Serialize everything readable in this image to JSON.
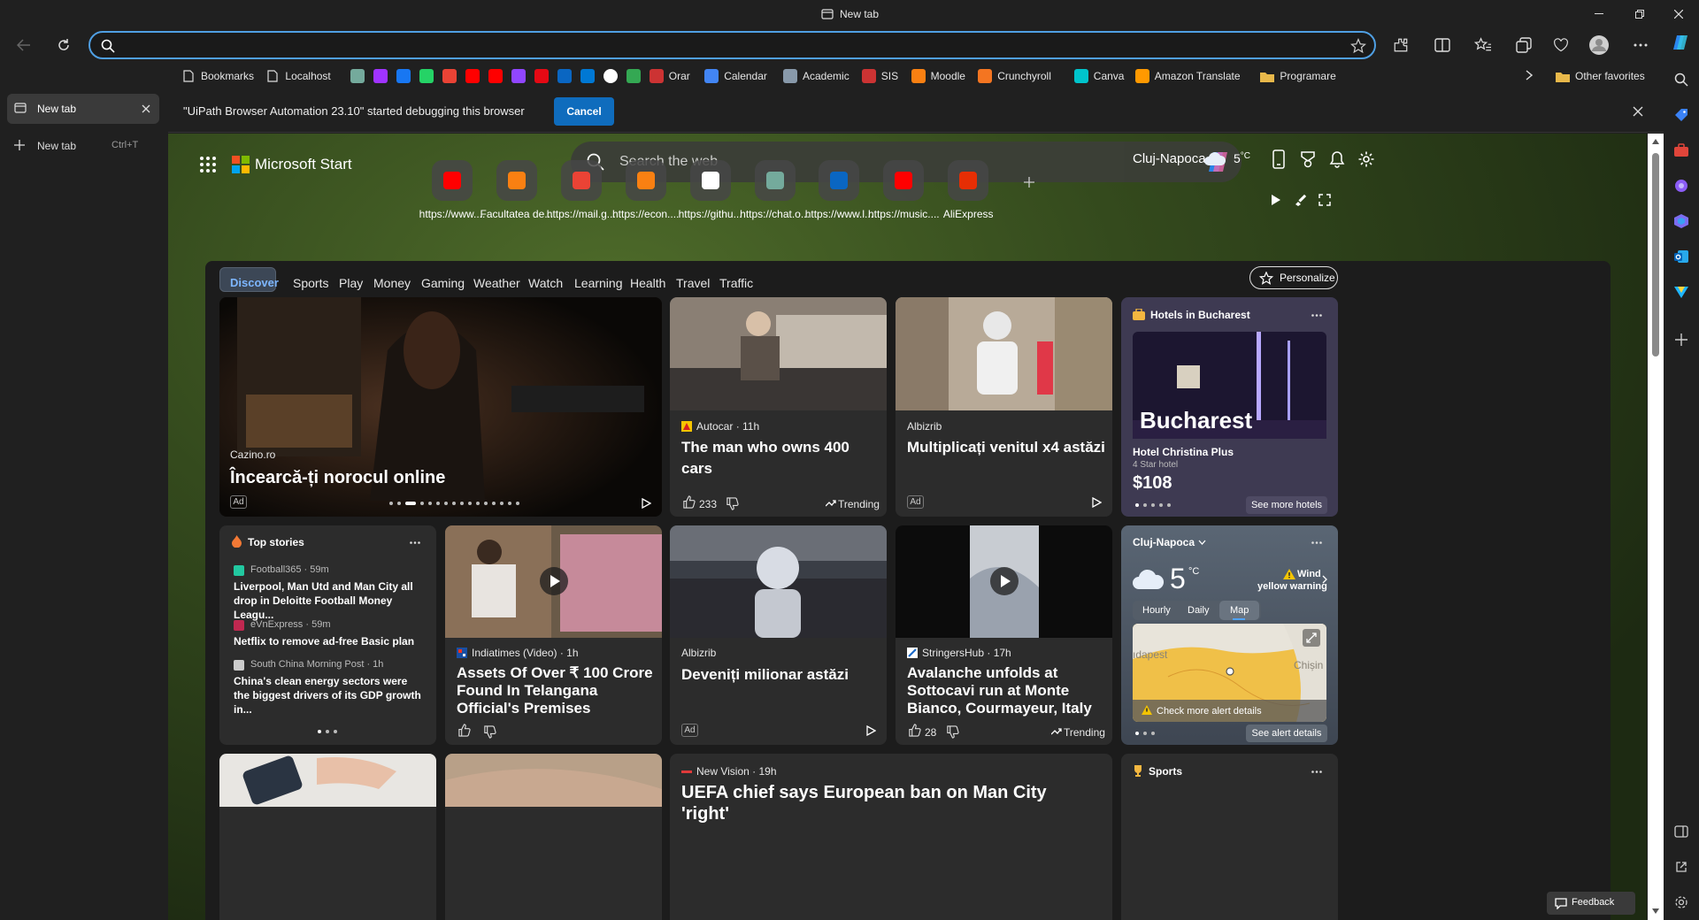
{
  "window": {
    "title": "New tab"
  },
  "address_bar": {
    "value": "",
    "placeholder": ""
  },
  "bookmarks": [
    {
      "label": "Bookmarks",
      "icon": "page-icon",
      "color": "#dddddd"
    },
    {
      "label": "Localhost",
      "icon": "page-icon",
      "color": "#dddddd"
    },
    {
      "label": "",
      "icon": "chatgpt-icon",
      "color": "#74aa9c"
    },
    {
      "label": "",
      "icon": "messenger-icon",
      "color": "#a033ff"
    },
    {
      "label": "",
      "icon": "facebook-icon",
      "color": "#1877f2"
    },
    {
      "label": "",
      "icon": "whatsapp-icon",
      "color": "#25d366"
    },
    {
      "label": "",
      "icon": "gmail-icon",
      "color": "#ea4335"
    },
    {
      "label": "",
      "icon": "youtube-icon",
      "color": "#ff0000"
    },
    {
      "label": "",
      "icon": "youtube-music-icon",
      "color": "#ff0000"
    },
    {
      "label": "",
      "icon": "twitch-icon",
      "color": "#9146ff"
    },
    {
      "label": "",
      "icon": "netflix-icon",
      "color": "#e50914"
    },
    {
      "label": "",
      "icon": "linkedin-icon",
      "color": "#0a66c2"
    },
    {
      "label": "",
      "icon": "outlook-icon",
      "color": "#0078d4"
    },
    {
      "label": "",
      "icon": "github-icon",
      "color": "#ffffff"
    },
    {
      "label": "",
      "icon": "drive-icon",
      "color": "#34a853"
    },
    {
      "label": "Orar",
      "icon": "orar-icon",
      "color": "#cc3333"
    },
    {
      "label": "Calendar",
      "icon": "calendar-icon",
      "color": "#4285f4"
    },
    {
      "label": "Academic",
      "icon": "academic-icon",
      "color": "#8899aa"
    },
    {
      "label": "SIS",
      "icon": "sis-icon",
      "color": "#cc3333"
    },
    {
      "label": "Moodle",
      "icon": "moodle-icon",
      "color": "#f98012"
    },
    {
      "label": "Crunchyroll",
      "icon": "crunchyroll-icon",
      "color": "#f47521"
    },
    {
      "label": "Canva",
      "icon": "canva-icon",
      "color": "#00c4cc"
    },
    {
      "label": "Amazon Translate",
      "icon": "amazon-icon",
      "color": "#ff9900"
    },
    {
      "label": "Programare",
      "icon": "folder-icon",
      "color": "#e8b84a"
    }
  ],
  "other_favorites": "Other favorites",
  "vertical_tabs": {
    "tab_label": "New tab",
    "new_tab": "New tab",
    "shortcut": "Ctrl+T"
  },
  "debug_banner": {
    "text": "\"UiPath Browser Automation 23.10\" started debugging this browser",
    "cancel": "Cancel"
  },
  "ms_start": {
    "brand": "Microsoft Start",
    "search_placeholder": "Search the web",
    "location": "Cluj-Napoca",
    "temp": "5",
    "temp_unit": "°C"
  },
  "quick_links": [
    {
      "label": "https://www....",
      "icon": "youtube-icon",
      "color": "#ff0000"
    },
    {
      "label": "Facultatea de...",
      "icon": "moodle-icon",
      "color": "#f98012"
    },
    {
      "label": "https://mail.g...",
      "icon": "gmail-icon",
      "color": "#ea4335"
    },
    {
      "label": "https://econ....",
      "icon": "moodle-icon",
      "color": "#f98012"
    },
    {
      "label": "https://githu...",
      "icon": "github-icon",
      "color": "#ffffff"
    },
    {
      "label": "https://chat.o...",
      "icon": "chatgpt-icon",
      "color": "#74aa9c"
    },
    {
      "label": "https://www.l...",
      "icon": "linkedin-icon",
      "color": "#0a66c2"
    },
    {
      "label": "https://music....",
      "icon": "youtube-music-icon",
      "color": "#ff0000"
    },
    {
      "label": "AliExpress",
      "icon": "aliexpress-icon",
      "color": "#e62e04"
    }
  ],
  "feed_tabs": [
    "Discover",
    "Sports",
    "Play",
    "Money",
    "Gaming",
    "Weather",
    "Watch",
    "Learning",
    "Health",
    "Travel",
    "Traffic"
  ],
  "personalize": "Personalize",
  "hero": {
    "source": "Cazino.ro",
    "title": "Încearcă-ți norocul online",
    "ad": "Ad"
  },
  "card_cars": {
    "source": "Autocar · 11h",
    "title": "The man who owns 400 cars",
    "likes": "233",
    "trending": "Trending"
  },
  "card_income": {
    "source": "Albizrib",
    "title": "Multiplicați venitul x4 astăzi",
    "ad": "Ad"
  },
  "hotels": {
    "header": "Hotels in Bucharest",
    "city": "Bucharest",
    "name": "Hotel Christina Plus",
    "stars": "4 Star hotel",
    "price": "$108",
    "more": "See more hotels"
  },
  "top_stories": {
    "header": "Top stories",
    "items": [
      {
        "source": "Football365 · 59m",
        "title": "Liverpool, Man Utd and Man City all drop in Deloitte Football Money Leagu..."
      },
      {
        "source": "eVnExpress · 59m",
        "title": "Netflix to remove ad-free Basic plan"
      },
      {
        "source": "South China Morning Post · 1h",
        "title": "China's clean energy sectors were the biggest drivers of its GDP growth in..."
      }
    ]
  },
  "card_crore": {
    "source": "Indiatimes (Video) · 1h",
    "title": "Assets Of Over ₹ 100 Crore Found In Telangana Official's Premises"
  },
  "card_milionar": {
    "source": "Albizrib",
    "title": "Deveniți milionar astăzi",
    "ad": "Ad"
  },
  "card_avalanche": {
    "source": "StringersHub · 17h",
    "title": "Avalanche unfolds at Sottocavi run at Monte Bianco, Courmayeur, Italy",
    "likes": "28",
    "trending": "Trending"
  },
  "weather": {
    "city": "Cluj-Napoca",
    "temp": "5",
    "unit": "°C",
    "alert_title": "Wind",
    "alert_sub": "yellow warning",
    "tabs": [
      "Hourly",
      "Daily",
      "Map"
    ],
    "map_left": "ıdapest",
    "map_right": "Chișin",
    "check": "Check more alert details",
    "see": "See alert details"
  },
  "card_uefa": {
    "source": "New Vision · 19h",
    "title": "UEFA chief says European ban on Man City 'right'"
  },
  "sports": {
    "header": "Sports"
  },
  "feedback": "Feedback"
}
